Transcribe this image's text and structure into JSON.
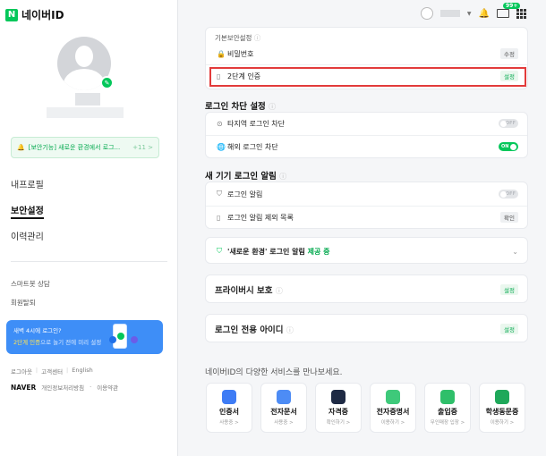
{
  "brand": {
    "logo_letter": "N",
    "logo_text": "네이버ID"
  },
  "profile": {
    "edit_icon": "pencil-icon"
  },
  "notice": {
    "text": "[보안기능] 새로운 환경에서 로그...",
    "count": "+11 >"
  },
  "nav": {
    "items": [
      "내프로필",
      "보안설정",
      "이력관리"
    ],
    "active": "보안설정"
  },
  "secondary_links": [
    "스마트봇 상담",
    "회원탈퇴"
  ],
  "promo": {
    "line1": "새벽 4시에 로그인?",
    "highlight": "2단계 인증",
    "line2": "으로 놀기 전에 미리 설정"
  },
  "footer": {
    "links": [
      "로그아웃",
      "고객센터",
      "English"
    ],
    "brand": "NAVER",
    "links2": [
      "개인정보처리방침",
      "이용약관"
    ]
  },
  "topbar": {
    "mail_badge": "99+"
  },
  "basic_security": {
    "title": "기본보안설정",
    "rows": [
      {
        "icon": "lock-icon",
        "label": "비밀번호",
        "action": "수정"
      },
      {
        "icon": "phone-icon",
        "label": "2단계 인증",
        "action": "설정"
      }
    ]
  },
  "login_block": {
    "title": "로그인 차단 설정",
    "rows": [
      {
        "label": "타지역 로그인 차단",
        "toggle": "OFF"
      },
      {
        "label": "해외 로그인 차단",
        "toggle": "ON"
      }
    ]
  },
  "new_device": {
    "title": "새 기기 로그인 알림",
    "rows": [
      {
        "label": "로그인 알림",
        "toggle": "OFF"
      },
      {
        "label": "로그인 알림 제외 목록",
        "action": "확인"
      }
    ]
  },
  "new_env": {
    "label": "'새로운 환경' 로그인 알림",
    "status": "제공 중"
  },
  "privacy": {
    "label": "프라이버시 보호",
    "action": "설정"
  },
  "login_only": {
    "label": "로그인 전용 아이디",
    "action": "설정"
  },
  "services": {
    "title": "네이버ID의 다양한 서비스를 만나보세요.",
    "items": [
      {
        "name": "인증서",
        "sub": "사용중 >",
        "color": "#3e7cf5"
      },
      {
        "name": "전자문서",
        "sub": "사용중 >",
        "color": "#4d8cf5"
      },
      {
        "name": "자격증",
        "sub": "확인하기 >",
        "color": "#1e2a44"
      },
      {
        "name": "전자증명서",
        "sub": "이용하기 >",
        "color": "#3ec97a"
      },
      {
        "name": "출입증",
        "sub": "무인매장 입장 >",
        "color": "#2fbf6a"
      },
      {
        "name": "학생동문증",
        "sub": "이용하기 >",
        "color": "#1fa85a"
      }
    ]
  }
}
